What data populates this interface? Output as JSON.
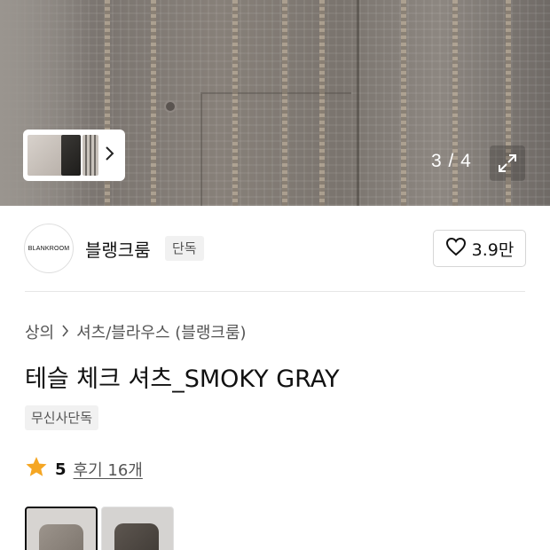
{
  "gallery": {
    "counter": "3 / 4",
    "thumbnails": [
      "thumb-light-shirt",
      "thumb-black-shirt",
      "thumb-check-shirt"
    ],
    "next_icon": "chevron-right-icon",
    "expand_icon": "expand-icon"
  },
  "brand": {
    "logo_text": "BLANKROOM",
    "name": "블랭크룸",
    "badge": "단독",
    "like_icon": "heart-icon",
    "like_count": "3.9만"
  },
  "breadcrumb": {
    "category": "상의",
    "separator_icon": "chevron-right-icon",
    "subcategory": "셔츠/블라우스 (블랭크룸)"
  },
  "product": {
    "title": "테슬 체크 셔츠_SMOKY GRAY",
    "tag": "무신사단독"
  },
  "rating": {
    "star_color": "#f5a623",
    "value": "5",
    "reviews": "후기 16개"
  },
  "variants": [
    {
      "name": "smoky-gray",
      "selected": true
    },
    {
      "name": "dark",
      "selected": false
    }
  ]
}
